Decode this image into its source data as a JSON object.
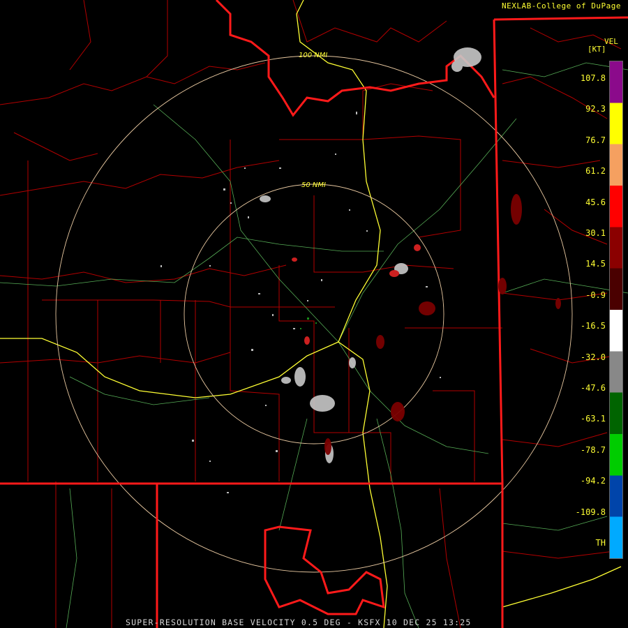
{
  "credit": "NEXLAB-College of DuPage",
  "footer": "SUPER-RESOLUTION BASE VELOCITY 0.5 DEG - KSFX 10 DEC 25 13:25",
  "legend": {
    "title": "VEL",
    "unit": "[KT]",
    "labels": [
      "107.8",
      "92.3",
      "76.7",
      "61.2",
      "45.6",
      "30.1",
      "14.5",
      "-0.9",
      "-16.5",
      "-32.0",
      "-47.6",
      "-63.1",
      "-78.7",
      "-94.2",
      "-109.8",
      "TH"
    ],
    "colors": [
      "#8b0a8b",
      "#ffff00",
      "#f5a060",
      "#ff0000",
      "#8b0000",
      "#4a0000",
      "#ffffff",
      "#888888",
      "#006400",
      "#00cc00",
      "#0044aa",
      "#00aaff"
    ]
  },
  "rings": [
    {
      "label": "100 NMI"
    },
    {
      "label": "50 NMI"
    }
  ]
}
